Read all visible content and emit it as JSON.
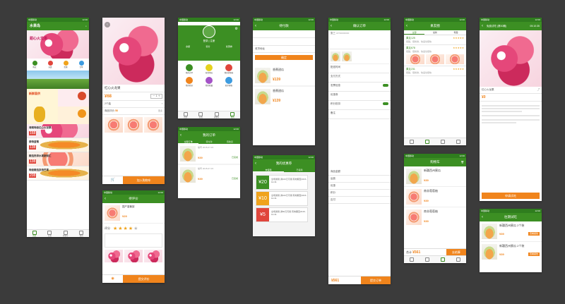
{
  "colors": {
    "primary_green": "#3c8f23",
    "dark_green": "#2f7d1e",
    "accent_orange": "#f0841c",
    "dragon_pink": "#e5477a",
    "background": "#3b3b3b"
  },
  "status": {
    "carrier": "中国移动",
    "time": "12:00"
  },
  "home": {
    "logo": "水果岛",
    "banner_text": "甜心火龙果",
    "nav": [
      "附近",
      "分类",
      "优惠",
      "订单"
    ],
    "promo_label": "新鲜直供",
    "items": [
      {
        "title": "海南特级红心火龙果",
        "price": "168"
      },
      {
        "title": "泰特蓝莓",
        "price": "138"
      },
      {
        "title": "精选热带水果新鲜汇",
        "price": "138"
      },
      {
        "title": "特级精选凯特芒果",
        "price": "208"
      }
    ],
    "tabs": [
      "首页",
      "分类",
      "购物车",
      "我的"
    ]
  },
  "detail": {
    "product": "红心火龙果",
    "price": "¥68",
    "spec": "2个装",
    "rating_label": "商品评价",
    "rating_count": "58",
    "more_label": "更多",
    "add_cart": "加入购物车"
  },
  "review": {
    "title": "待评价",
    "product": "国产香蕉梨",
    "price": "¥29",
    "score_label": "评分",
    "stars": 4,
    "submit": "提交评价"
  },
  "profile": {
    "username": "登录 | 注册",
    "stats": [
      "余额",
      "积分",
      "优惠券"
    ],
    "menu": [
      "我的订单",
      "收货地址",
      "我的优惠券",
      "我的积分",
      "我的收藏",
      "联系客服"
    ],
    "tabs": [
      "首页",
      "分类",
      "购物车",
      "我的"
    ]
  },
  "orders": {
    "title": "我的订单",
    "tabs": [
      "全部订单",
      "待付款",
      "待收货"
    ],
    "list": [
      {
        "label": "编号",
        "date": "2015-07-15",
        "price": "¥39",
        "status": "已完成"
      },
      {
        "label": "编号",
        "date": "2015-07-15",
        "price": "¥39",
        "status": "已完成"
      }
    ]
  },
  "coupon_pick": {
    "title": "待付款",
    "tip": "收货地址",
    "confirm": "确定",
    "items": [
      {
        "name": "香蕉甜瓜",
        "price": "¥139"
      },
      {
        "name": "香蕉甜瓜",
        "price": "¥139"
      }
    ]
  },
  "my_coupons": {
    "title": "我的优惠券",
    "tabs": [
      "未使用",
      "已使用"
    ],
    "list": [
      {
        "amount": "20",
        "text": "全场通用 满100元可用 有效期至2015-12-31"
      },
      {
        "amount": "10",
        "text": "全场通用 满100元可用 有效期至2015-12-31"
      },
      {
        "amount": "5",
        "text": "全场通用 满50元可用 有效期至2015-12-31"
      }
    ]
  },
  "checkout": {
    "title": "确认订单",
    "address_name": "张三",
    "address_phone": "18700000000",
    "rows": [
      "配送时间",
      "支付方式",
      "发票信息",
      "优惠券",
      "积分抵扣",
      "备注"
    ],
    "sub_rows": [
      "商品金额",
      "运费",
      "优惠",
      "积分",
      "应付"
    ],
    "total": "¥561",
    "submit": "提交订单"
  },
  "reviews": {
    "title": "果友圈",
    "tabs": [
      "全部",
      "最新",
      "有图"
    ],
    "entries": [
      {
        "user": "果友125",
        "text": "很甜，很新鲜，快递也很快"
      },
      {
        "user": "果友678",
        "text": "很甜，很新鲜，快递也很快"
      },
      {
        "user": "果友231",
        "text": "很甜，很新鲜，快递也很快"
      }
    ]
  },
  "cart": {
    "title": "购物车",
    "items": [
      {
        "name": "新疆西州蜜瓜",
        "price": "¥39"
      },
      {
        "name": "南非葡萄柚",
        "price": "¥39"
      },
      {
        "name": "南非葡萄柚",
        "price": "¥39"
      }
    ],
    "total_label": "合计",
    "total": "¥561",
    "checkout": "去结算"
  },
  "group_buy": {
    "title": "免费试吃 (第30期)",
    "timer": "05:10:35",
    "product": "红心火龙果",
    "price": "¥0",
    "apply": "申请试吃"
  },
  "trial_list": {
    "title": "往期试吃",
    "items": [
      {
        "name": "新疆西州蜜瓜 2个装",
        "price": "¥39",
        "btn": "查看报告"
      },
      {
        "name": "新疆西州蜜瓜 2个装",
        "price": "¥39",
        "btn": "查看报告"
      }
    ]
  }
}
